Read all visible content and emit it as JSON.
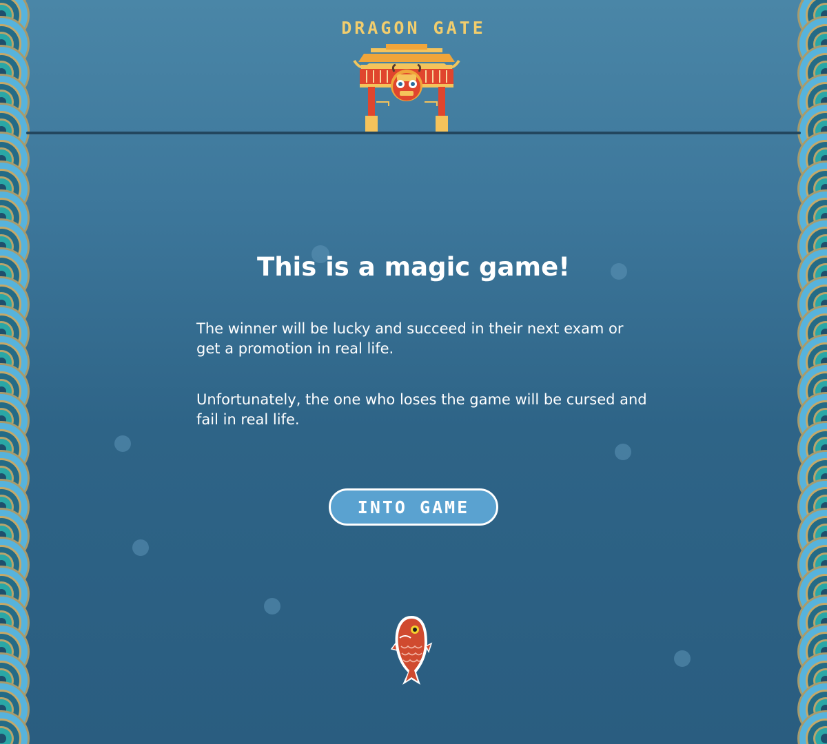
{
  "game": {
    "title": "DRAGON GATE",
    "headline": "This is a magic game!",
    "paragraphs": [
      "The winner will be lucky and succeed in their next exam or get a promotion in real life.",
      "Unfortunately, the one who loses the game will be cursed and fail in real life."
    ],
    "start_button_label": "INTO GAME"
  },
  "icons": {
    "gate": "dragon-gate-icon",
    "player": "koi-fish-icon",
    "border": "wave-pattern"
  },
  "colors": {
    "background_top": "#4a86a7",
    "background_bottom": "#2a5d80",
    "title_gold": "#f1cd6d",
    "button_fill": "#5aa2d0",
    "fish_red": "#d04a2f",
    "gate_red": "#e0452d"
  }
}
